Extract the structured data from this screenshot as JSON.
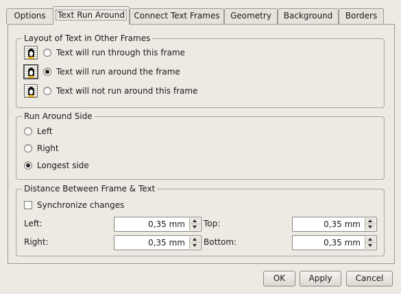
{
  "tabs": [
    {
      "label": "Options",
      "active": false
    },
    {
      "label": "Text Run Around",
      "active": true
    },
    {
      "label": "Connect Text Frames",
      "active": false
    },
    {
      "label": "Geometry",
      "active": false
    },
    {
      "label": "Background",
      "active": false
    },
    {
      "label": "Borders",
      "active": false
    }
  ],
  "layout_group": {
    "title": "Layout of Text in Other Frames",
    "options": [
      {
        "label": "Text will run through this frame",
        "selected": false
      },
      {
        "label": "Text will run around the frame",
        "selected": true
      },
      {
        "label": "Text will not run around this frame",
        "selected": false
      }
    ]
  },
  "side_group": {
    "title": "Run Around Side",
    "options": [
      {
        "label": "Left",
        "selected": false
      },
      {
        "label": "Right",
        "selected": false
      },
      {
        "label": "Longest side",
        "selected": true
      }
    ]
  },
  "distance_group": {
    "title": "Distance Between Frame & Text",
    "sync_label": "Synchronize changes",
    "sync_checked": false,
    "left_label": "Left:",
    "left_value": "0,35 mm",
    "top_label": "Top:",
    "top_value": "0,35 mm",
    "right_label": "Right:",
    "right_value": "0,35 mm",
    "bottom_label": "Bottom:",
    "bottom_value": "0,35 mm"
  },
  "buttons": {
    "ok": "OK",
    "apply": "Apply",
    "cancel": "Cancel"
  }
}
